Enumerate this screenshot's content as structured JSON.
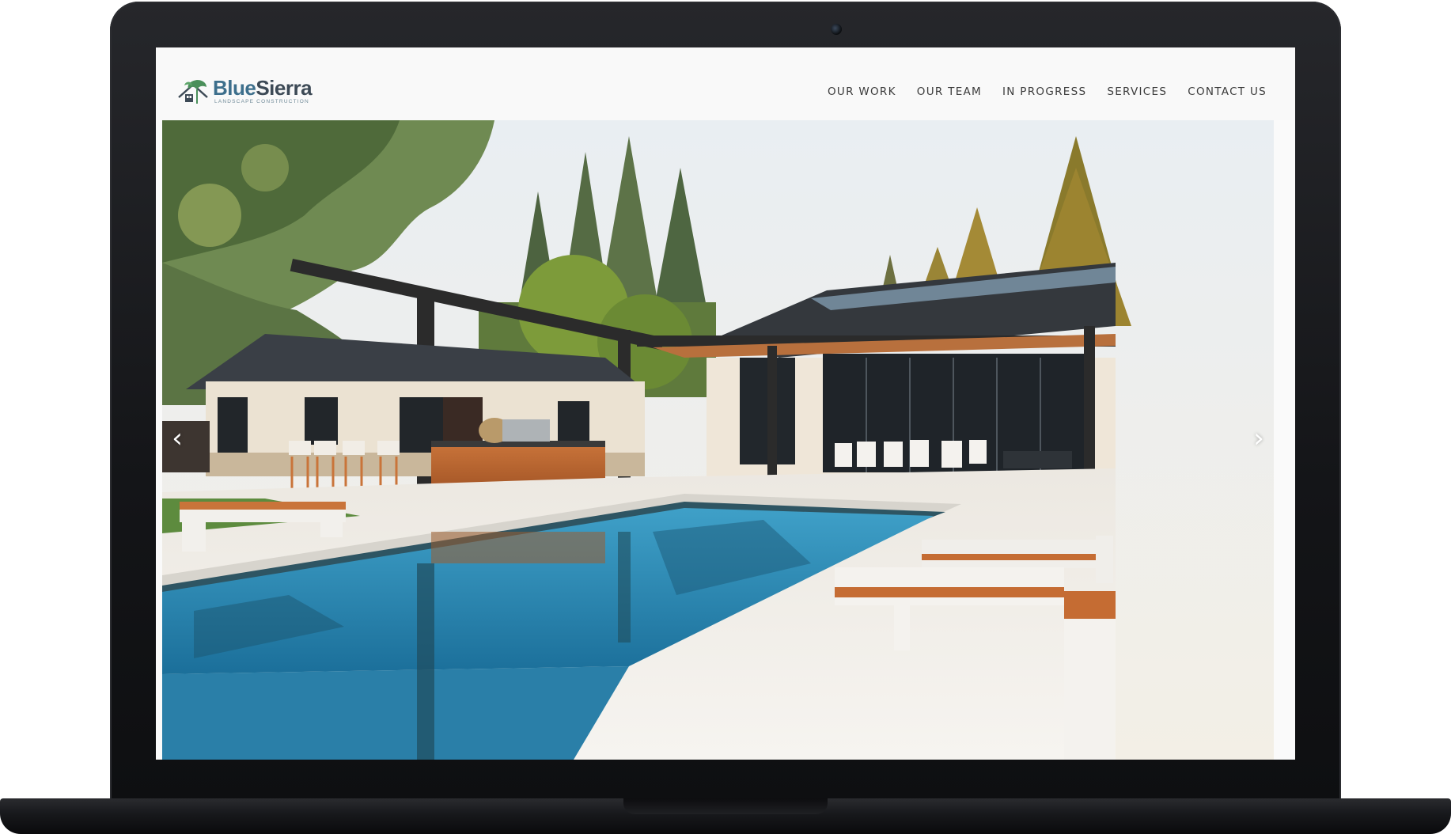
{
  "brand": {
    "name_part1": "Blue",
    "name_part2": "Sierra",
    "tagline": "LANDSCAPE CONSTRUCTION",
    "colors": {
      "blue": "#3d6f8c",
      "dark": "#3d4a56",
      "green": "#4a8f5a"
    }
  },
  "nav": {
    "items": [
      {
        "label": "OUR WORK"
      },
      {
        "label": "OUR TEAM"
      },
      {
        "label": "IN PROGRESS"
      },
      {
        "label": "SERVICES"
      },
      {
        "label": "CONTACT US"
      }
    ]
  },
  "slider": {
    "prev_icon": "chevron-left-icon",
    "next_icon": "chevron-right-icon",
    "prev_glyph": "‹",
    "next_glyph": "›"
  }
}
